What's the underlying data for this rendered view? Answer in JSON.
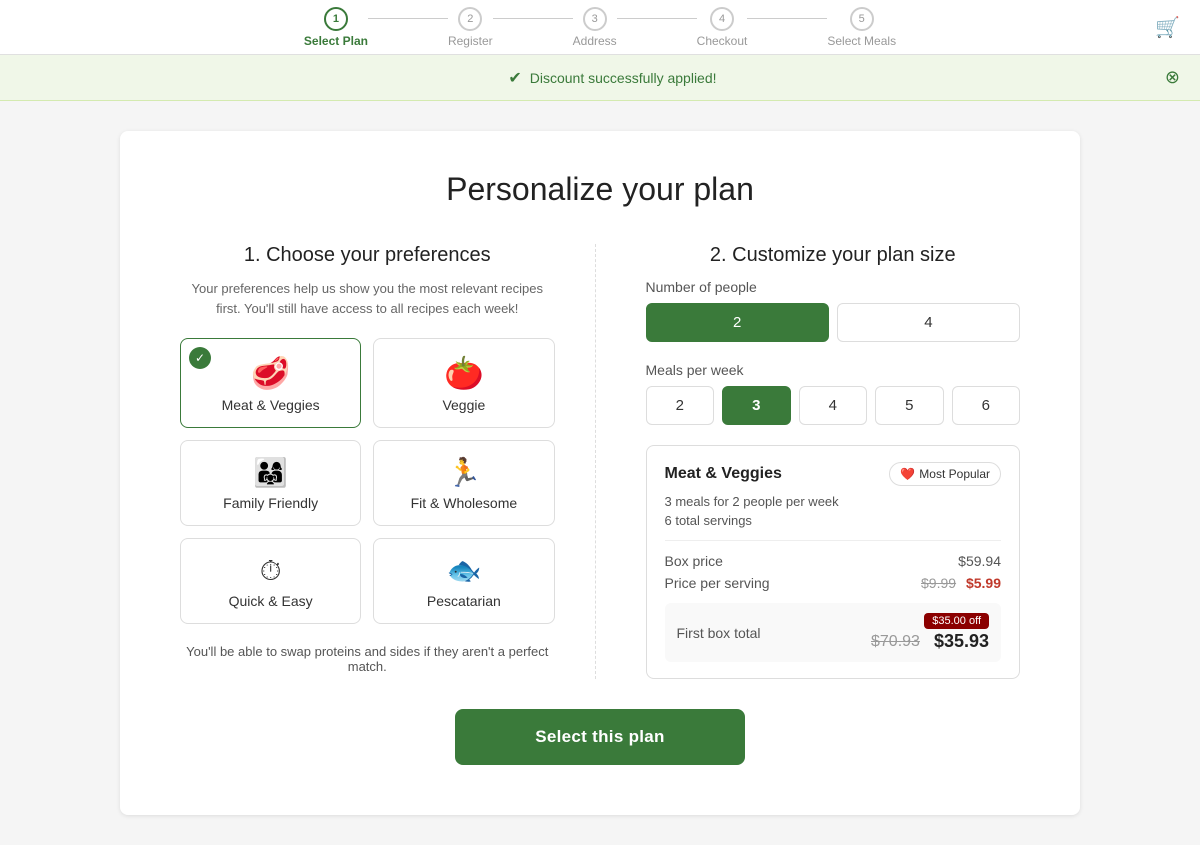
{
  "header": {
    "steps": [
      {
        "num": "1",
        "label": "Select Plan",
        "active": true
      },
      {
        "num": "2",
        "label": "Register",
        "active": false
      },
      {
        "num": "3",
        "label": "Address",
        "active": false
      },
      {
        "num": "4",
        "label": "Checkout",
        "active": false
      },
      {
        "num": "5",
        "label": "Select Meals",
        "active": false
      }
    ]
  },
  "discount_banner": {
    "message": "Discount successfully applied!",
    "icon": "✔"
  },
  "page": {
    "title": "Personalize your plan",
    "left_section_title": "1. Choose your preferences",
    "left_subtitle": "Your preferences help us show you the most relevant recipes first. You'll still have access to all recipes each week!",
    "preferences": [
      {
        "id": "meat-veggies",
        "label": "Meat & Veggies",
        "icon_class": "icon-meat",
        "selected": true
      },
      {
        "id": "veggie",
        "label": "Veggie",
        "icon_class": "icon-veggie",
        "selected": false
      },
      {
        "id": "family-friendly",
        "label": "Family Friendly",
        "icon_class": "icon-family",
        "selected": false
      },
      {
        "id": "fit-wholesome",
        "label": "Fit & Wholesome",
        "icon_class": "icon-fit",
        "selected": false
      },
      {
        "id": "quick-easy",
        "label": "Quick & Easy",
        "icon_class": "icon-quick",
        "selected": false
      },
      {
        "id": "pescatarian",
        "label": "Pescatarian",
        "icon_class": "icon-fish",
        "selected": false
      }
    ],
    "swap_note": "You'll be able to swap proteins and sides if they aren't a perfect match.",
    "right_section_title": "2. Customize your plan size",
    "people_label": "Number of people",
    "people_options": [
      {
        "value": "2",
        "selected": true
      },
      {
        "value": "4",
        "selected": false
      }
    ],
    "meals_label": "Meals per week",
    "meals_options": [
      {
        "value": "2",
        "selected": false
      },
      {
        "value": "3",
        "selected": true
      },
      {
        "value": "4",
        "selected": false
      },
      {
        "value": "5",
        "selected": false
      },
      {
        "value": "6",
        "selected": false
      }
    ],
    "summary": {
      "plan_name": "Meat & Veggies",
      "badge": "Most Popular",
      "description_line1": "3 meals for 2 people per week",
      "description_line2": "6 total servings",
      "box_price_label": "Box price",
      "box_price_value": "$59.94",
      "per_serving_label": "Price per serving",
      "per_serving_original": "$9.99",
      "per_serving_discounted": "$5.99",
      "first_box_label": "First box total",
      "first_box_discount_tag": "$35.00 off",
      "first_box_original": "$70.93",
      "first_box_final": "$35.93"
    },
    "cta_label": "Select this plan"
  }
}
